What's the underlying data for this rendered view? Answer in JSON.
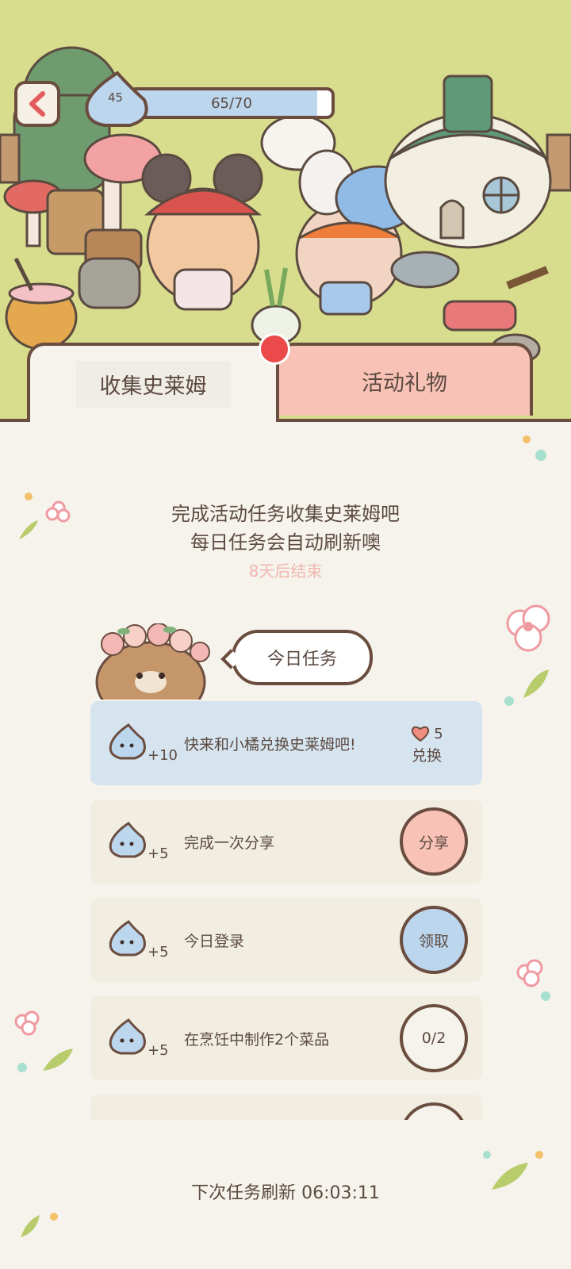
{
  "header": {
    "slime_count": "45",
    "progress_text": "65/70",
    "progress_fraction": 0.93
  },
  "tabs": [
    {
      "label": "收集史莱姆",
      "active": true
    },
    {
      "label": "活动礼物",
      "active": false
    }
  ],
  "info": {
    "line1": "完成活动任务收集史莱姆吧",
    "line2": "每日任务会自动刷新噢",
    "ends": "8天后结束"
  },
  "daily": {
    "title": "今日任务"
  },
  "tasks": [
    {
      "reward": "+10",
      "desc": "快来和小橘兑换史莱姆吧!",
      "cost": "5",
      "action": "兑换",
      "style": "exchange"
    },
    {
      "reward": "+5",
      "desc": "完成一次分享",
      "action": "分享",
      "style": "share"
    },
    {
      "reward": "+5",
      "desc": "今日登录",
      "action": "领取",
      "style": "claim"
    },
    {
      "reward": "+5",
      "desc": "在烹饪中制作2个菜品",
      "action": "0/2",
      "style": "progress"
    }
  ],
  "footer": {
    "refresh": "下次任务刷新 06:03:11"
  },
  "colors": {
    "outline": "#6b4d3f",
    "grass": "#d8dd8e",
    "panel": "#f5f3ec",
    "pink": "#f8c3b6",
    "blue": "#bcd6ee",
    "card": "#f1eee1",
    "card_highlight": "#d6e4ef",
    "muted_pink_text": "#f0b7ae"
  }
}
